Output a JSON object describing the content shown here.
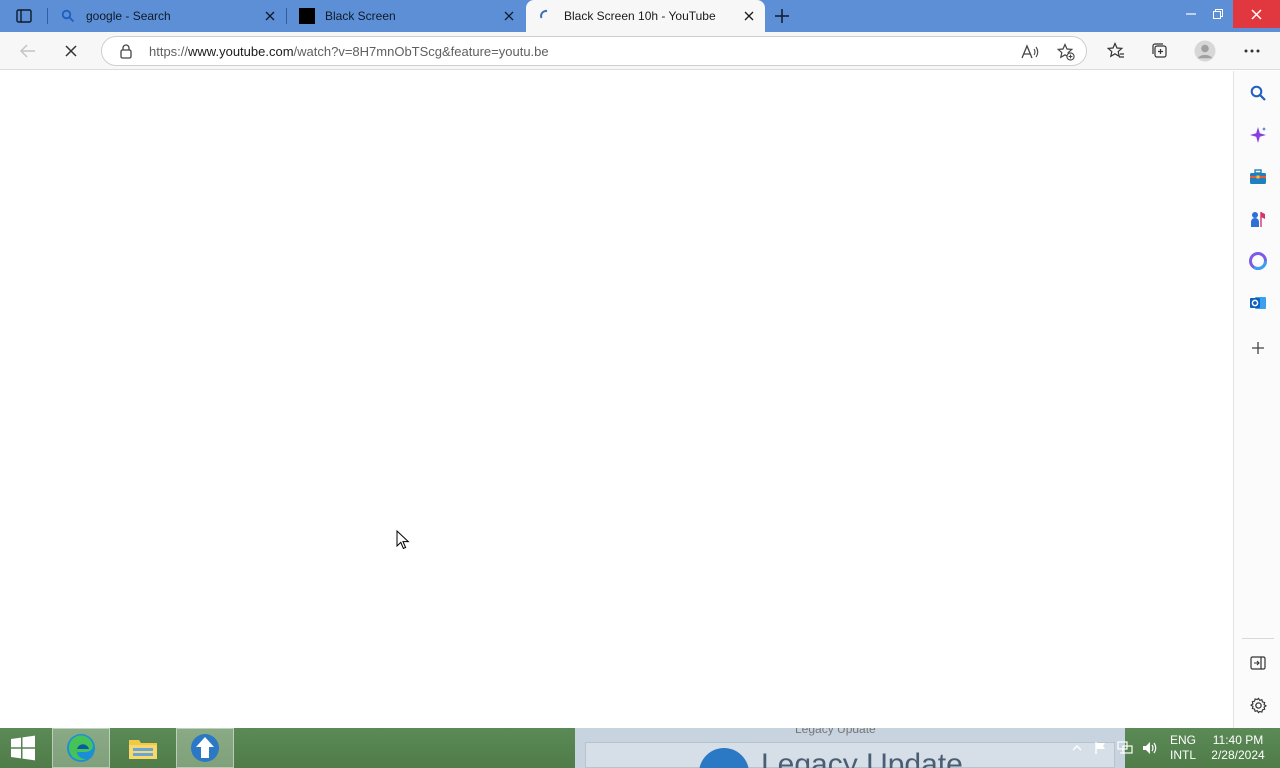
{
  "browser": {
    "tabs": [
      {
        "title": "google - Search",
        "favicon": "search-icon",
        "active": false
      },
      {
        "title": "Black Screen",
        "favicon": "black-square-icon",
        "active": false
      },
      {
        "title": "Black Screen 10h - YouTube",
        "favicon": "loading-spinner-icon",
        "active": true
      }
    ],
    "address": {
      "url_prefix": "https://",
      "url_host": "www.youtube.com",
      "url_rest": "/watch?v=8H7mnObTScg&feature=youtu.be"
    }
  },
  "sidebar": {
    "items": [
      "search-icon",
      "copilot-icon",
      "tools-icon",
      "games-icon",
      "office-icon",
      "outlook-icon",
      "add-icon"
    ],
    "bottom": [
      "hide-sidebar-icon",
      "settings-icon"
    ]
  },
  "taskbar": {
    "apps": [
      "edge-icon",
      "file-explorer-icon",
      "legacy-update-icon"
    ],
    "wallpaper_text_small": "Legacy Update",
    "wallpaper_text_large": "Legacy Update",
    "language_line1": "ENG",
    "language_line2": "INTL",
    "time": "11:40 PM",
    "date": "2/28/2024"
  },
  "colors": {
    "tabstrip": "#5d8fd6",
    "active_tab": "#f7f7f7",
    "taskbar": "#4f7c49",
    "close_button": "#e0383e"
  }
}
